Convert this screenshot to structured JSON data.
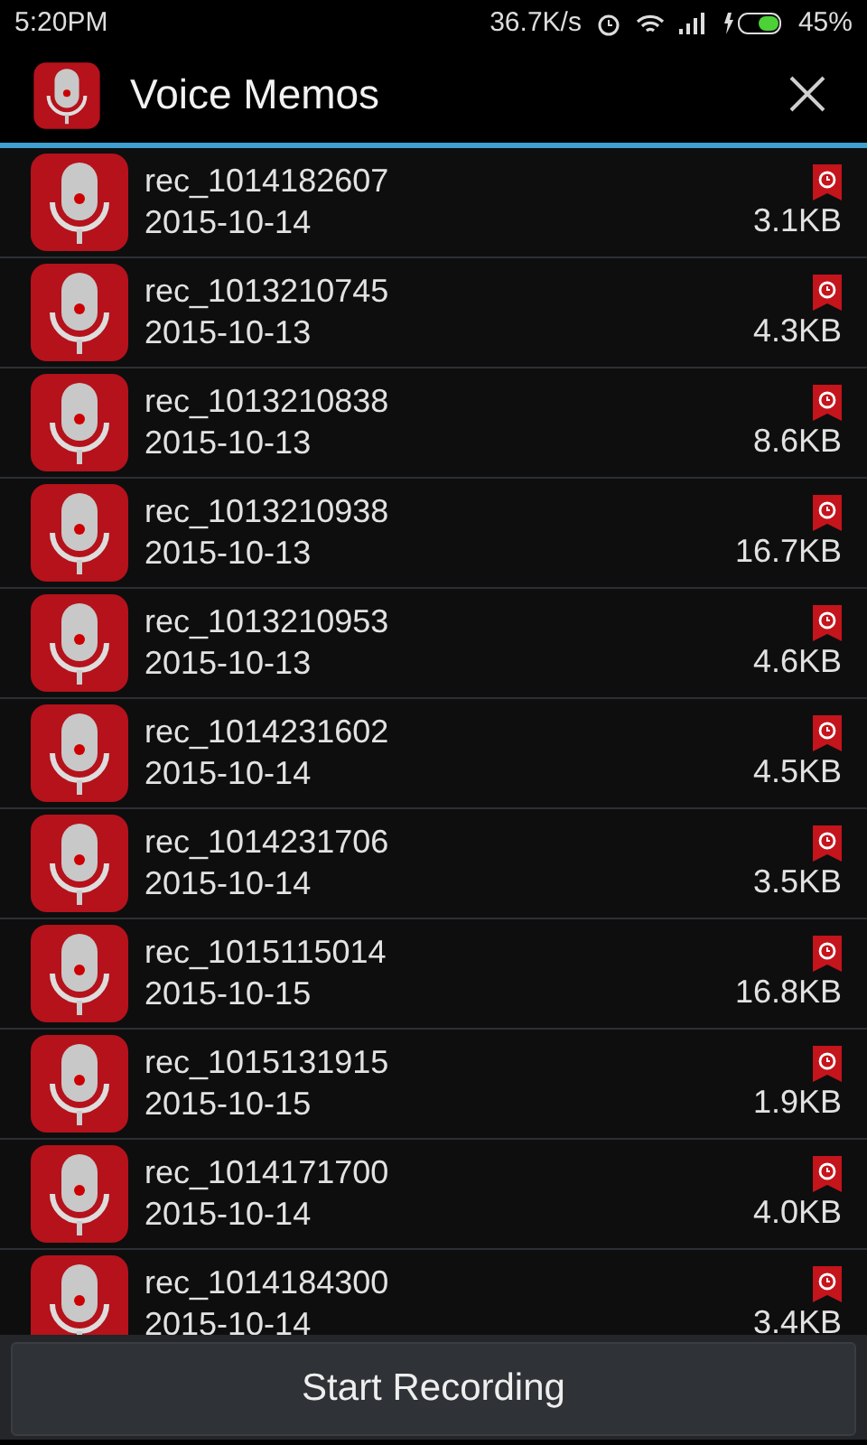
{
  "status_bar": {
    "time": "5:20PM",
    "speed": "36.7K/s",
    "battery": "45%"
  },
  "header": {
    "title": "Voice Memos"
  },
  "recordings": [
    {
      "name": "rec_1014182607",
      "date": "2015-10-14",
      "size": "3.1KB"
    },
    {
      "name": "rec_1013210745",
      "date": "2015-10-13",
      "size": "4.3KB"
    },
    {
      "name": "rec_1013210838",
      "date": "2015-10-13",
      "size": "8.6KB"
    },
    {
      "name": "rec_1013210938",
      "date": "2015-10-13",
      "size": "16.7KB"
    },
    {
      "name": "rec_1013210953",
      "date": "2015-10-13",
      "size": "4.6KB"
    },
    {
      "name": "rec_1014231602",
      "date": "2015-10-14",
      "size": "4.5KB"
    },
    {
      "name": "rec_1014231706",
      "date": "2015-10-14",
      "size": "3.5KB"
    },
    {
      "name": "rec_1015115014",
      "date": "2015-10-15",
      "size": "16.8KB"
    },
    {
      "name": "rec_1015131915",
      "date": "2015-10-15",
      "size": "1.9KB"
    },
    {
      "name": "rec_1014171700",
      "date": "2015-10-14",
      "size": "4.0KB"
    },
    {
      "name": "rec_1014184300",
      "date": "2015-10-14",
      "size": "3.4KB"
    }
  ],
  "footer": {
    "button": "Start Recording"
  }
}
